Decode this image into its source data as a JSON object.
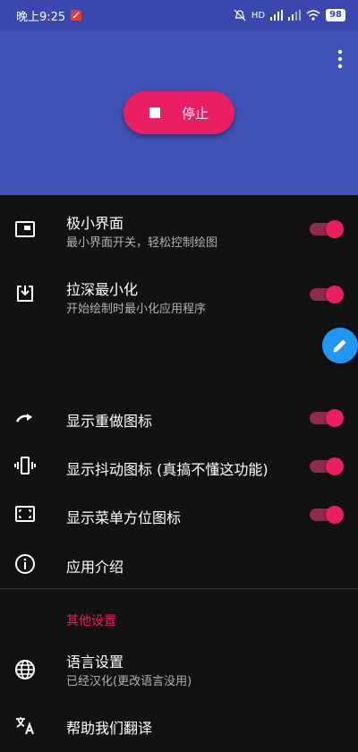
{
  "status": {
    "time": "晚上9:25",
    "battery": "98",
    "network": "HD"
  },
  "header": {
    "stop_label": "停止"
  },
  "settings": {
    "mini_ui": {
      "title": "极小界面",
      "subtitle": "最小界面开关，轻松控制绘图",
      "enabled": true
    },
    "pull_minimize": {
      "title": "拉深最小化",
      "subtitle": "开始绘制时最小化应用程序",
      "enabled": true
    },
    "show_redo": {
      "title": "显示重做图标",
      "enabled": true
    },
    "show_vibrate": {
      "title": "显示抖动图标 (真搞不懂这功能)",
      "enabled": true
    },
    "show_menu_pos": {
      "title": "显示菜单方位图标",
      "enabled": true
    },
    "about": {
      "title": "应用介绍"
    }
  },
  "other_section": {
    "header": "其他设置",
    "language": {
      "title": "语言设置",
      "subtitle": "已经汉化(更改语言没用)"
    },
    "translate": {
      "title": "帮助我们翻译"
    }
  },
  "colors": {
    "primary": "#3f51b5",
    "accent": "#e91e63",
    "fab": "#2196f3",
    "background": "#121212"
  }
}
